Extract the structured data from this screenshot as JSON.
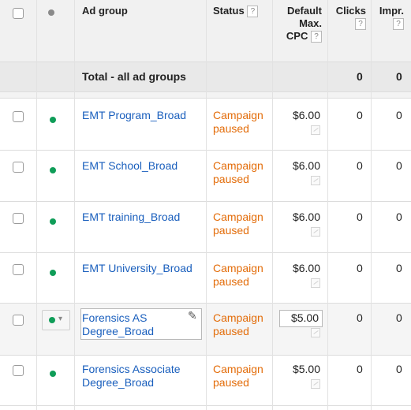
{
  "header": {
    "ad_group_label": "Ad group",
    "status_label": "Status",
    "cpc_label_line1": "Default",
    "cpc_label_line2": "Max.",
    "cpc_label_line3": "CPC",
    "clicks_label": "Clicks",
    "impr_label": "Impr.",
    "help_glyph": "?"
  },
  "total_row": {
    "label": "Total - all ad groups",
    "clicks": "0",
    "impr": "0"
  },
  "rows": [
    {
      "name": "EMT Program_Broad",
      "status_line1": "Campaign",
      "status_line2": "paused",
      "cpc": "$6.00",
      "clicks": "0",
      "impr": "0"
    },
    {
      "name": "EMT School_Broad",
      "status_line1": "Campaign",
      "status_line2": "paused",
      "cpc": "$6.00",
      "clicks": "0",
      "impr": "0"
    },
    {
      "name": "EMT training_Broad",
      "status_line1": "Campaign",
      "status_line2": "paused",
      "cpc": "$6.00",
      "clicks": "0",
      "impr": "0"
    },
    {
      "name": "EMT University_Broad",
      "status_line1": "Campaign",
      "status_line2": "paused",
      "cpc": "$6.00",
      "clicks": "0",
      "impr": "0"
    },
    {
      "name_line1": "Forensics AS",
      "name_line2": "Degree_Broad",
      "status_line1": "Campaign",
      "status_line2": "paused",
      "cpc": "$5.00",
      "clicks": "0",
      "impr": "0"
    },
    {
      "name_line1": "Forensics Associate",
      "name_line2": "Degree_Broad",
      "status_line1": "Campaign",
      "status_line2": "paused",
      "cpc": "$5.00",
      "clicks": "0",
      "impr": "0"
    }
  ],
  "colors": {
    "link": "#1a5fbd",
    "status_paused": "#e36c09",
    "enabled_dot": "#0f9d58",
    "header_bg": "#f1f1f1",
    "hover_row_bg": "#f5f5f5"
  },
  "icons": {
    "enabled_status": "green-dot-icon",
    "header_status": "grey-dot-icon",
    "edit": "pencil-icon",
    "trend": "trend-chart-icon",
    "dropdown": "chevron-down-icon"
  }
}
